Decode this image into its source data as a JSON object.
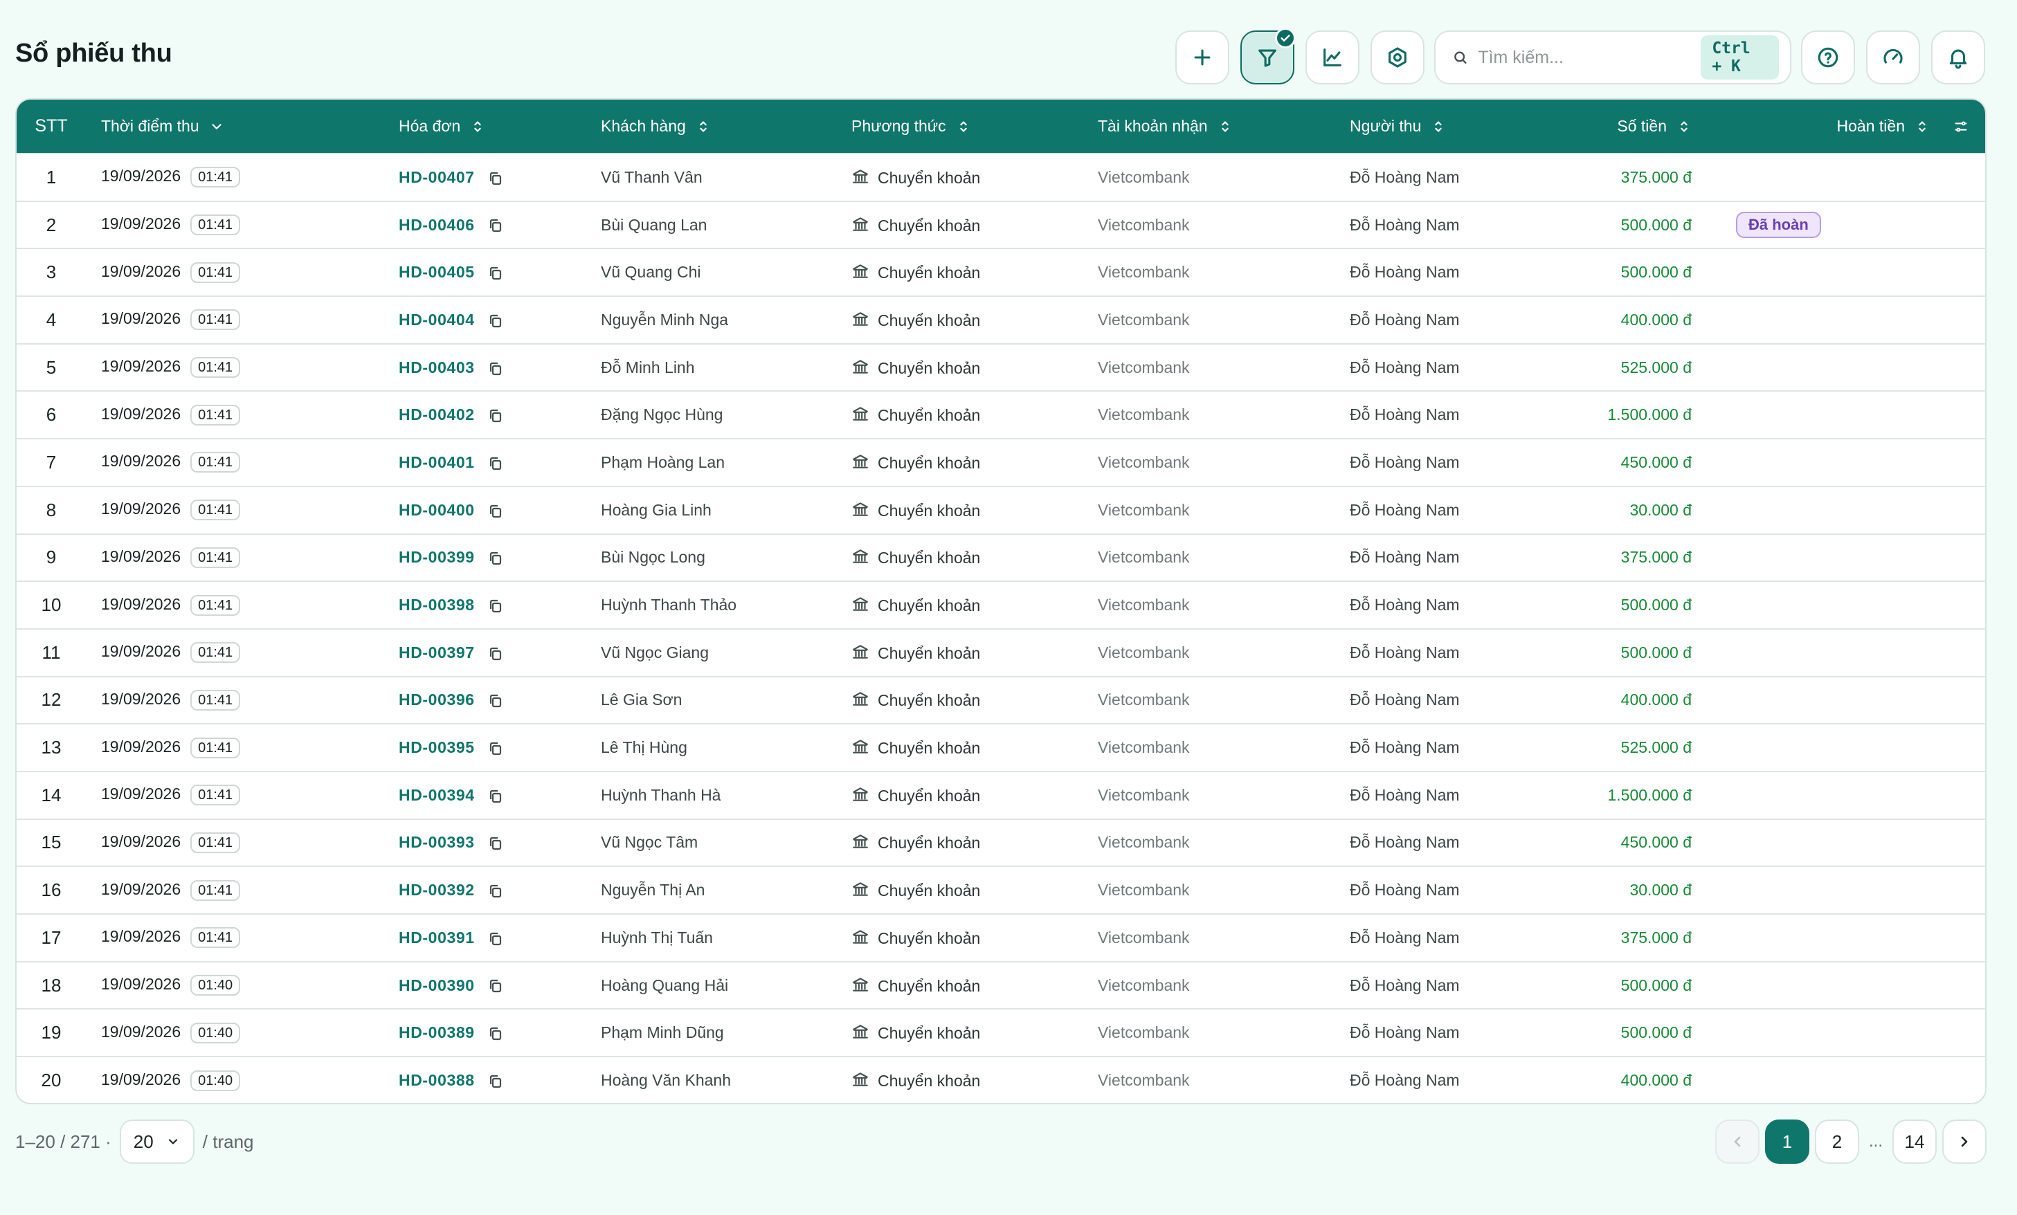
{
  "page_title": "Sổ phiếu thu",
  "search": {
    "placeholder": "Tìm kiếm...",
    "shortcut": "Ctrl + K"
  },
  "table": {
    "columns": {
      "stt": "STT",
      "time": "Thời điểm thu",
      "invoice": "Hóa đơn",
      "customer": "Khách hàng",
      "method": "Phương thức",
      "account": "Tài khoản nhận",
      "collector": "Người thu",
      "amount": "Số tiền",
      "refund": "Hoàn tiền"
    },
    "rows": [
      {
        "stt": "1",
        "date": "19/09/2026",
        "time": "01:41",
        "invoice": "HD-00407",
        "customer": "Vũ Thanh Vân",
        "method": "Chuyển khoản",
        "account": "Vietcombank",
        "collector": "Đỗ Hoàng Nam",
        "amount": "375.000 đ",
        "refund": ""
      },
      {
        "stt": "2",
        "date": "19/09/2026",
        "time": "01:41",
        "invoice": "HD-00406",
        "customer": "Bùi Quang Lan",
        "method": "Chuyển khoản",
        "account": "Vietcombank",
        "collector": "Đỗ Hoàng Nam",
        "amount": "500.000 đ",
        "refund": "Đã hoàn"
      },
      {
        "stt": "3",
        "date": "19/09/2026",
        "time": "01:41",
        "invoice": "HD-00405",
        "customer": "Vũ Quang Chi",
        "method": "Chuyển khoản",
        "account": "Vietcombank",
        "collector": "Đỗ Hoàng Nam",
        "amount": "500.000 đ",
        "refund": ""
      },
      {
        "stt": "4",
        "date": "19/09/2026",
        "time": "01:41",
        "invoice": "HD-00404",
        "customer": "Nguyễn Minh Nga",
        "method": "Chuyển khoản",
        "account": "Vietcombank",
        "collector": "Đỗ Hoàng Nam",
        "amount": "400.000 đ",
        "refund": ""
      },
      {
        "stt": "5",
        "date": "19/09/2026",
        "time": "01:41",
        "invoice": "HD-00403",
        "customer": "Đỗ Minh Linh",
        "method": "Chuyển khoản",
        "account": "Vietcombank",
        "collector": "Đỗ Hoàng Nam",
        "amount": "525.000 đ",
        "refund": ""
      },
      {
        "stt": "6",
        "date": "19/09/2026",
        "time": "01:41",
        "invoice": "HD-00402",
        "customer": "Đặng Ngọc Hùng",
        "method": "Chuyển khoản",
        "account": "Vietcombank",
        "collector": "Đỗ Hoàng Nam",
        "amount": "1.500.000 đ",
        "refund": ""
      },
      {
        "stt": "7",
        "date": "19/09/2026",
        "time": "01:41",
        "invoice": "HD-00401",
        "customer": "Phạm Hoàng Lan",
        "method": "Chuyển khoản",
        "account": "Vietcombank",
        "collector": "Đỗ Hoàng Nam",
        "amount": "450.000 đ",
        "refund": ""
      },
      {
        "stt": "8",
        "date": "19/09/2026",
        "time": "01:41",
        "invoice": "HD-00400",
        "customer": "Hoàng Gia Linh",
        "method": "Chuyển khoản",
        "account": "Vietcombank",
        "collector": "Đỗ Hoàng Nam",
        "amount": "30.000 đ",
        "refund": ""
      },
      {
        "stt": "9",
        "date": "19/09/2026",
        "time": "01:41",
        "invoice": "HD-00399",
        "customer": "Bùi Ngọc Long",
        "method": "Chuyển khoản",
        "account": "Vietcombank",
        "collector": "Đỗ Hoàng Nam",
        "amount": "375.000 đ",
        "refund": ""
      },
      {
        "stt": "10",
        "date": "19/09/2026",
        "time": "01:41",
        "invoice": "HD-00398",
        "customer": "Huỳnh Thanh Thảo",
        "method": "Chuyển khoản",
        "account": "Vietcombank",
        "collector": "Đỗ Hoàng Nam",
        "amount": "500.000 đ",
        "refund": ""
      },
      {
        "stt": "11",
        "date": "19/09/2026",
        "time": "01:41",
        "invoice": "HD-00397",
        "customer": "Vũ Ngọc Giang",
        "method": "Chuyển khoản",
        "account": "Vietcombank",
        "collector": "Đỗ Hoàng Nam",
        "amount": "500.000 đ",
        "refund": ""
      },
      {
        "stt": "12",
        "date": "19/09/2026",
        "time": "01:41",
        "invoice": "HD-00396",
        "customer": "Lê Gia Sơn",
        "method": "Chuyển khoản",
        "account": "Vietcombank",
        "collector": "Đỗ Hoàng Nam",
        "amount": "400.000 đ",
        "refund": ""
      },
      {
        "stt": "13",
        "date": "19/09/2026",
        "time": "01:41",
        "invoice": "HD-00395",
        "customer": "Lê Thị Hùng",
        "method": "Chuyển khoản",
        "account": "Vietcombank",
        "collector": "Đỗ Hoàng Nam",
        "amount": "525.000 đ",
        "refund": ""
      },
      {
        "stt": "14",
        "date": "19/09/2026",
        "time": "01:41",
        "invoice": "HD-00394",
        "customer": "Huỳnh Thanh Hà",
        "method": "Chuyển khoản",
        "account": "Vietcombank",
        "collector": "Đỗ Hoàng Nam",
        "amount": "1.500.000 đ",
        "refund": ""
      },
      {
        "stt": "15",
        "date": "19/09/2026",
        "time": "01:41",
        "invoice": "HD-00393",
        "customer": "Vũ Ngọc Tâm",
        "method": "Chuyển khoản",
        "account": "Vietcombank",
        "collector": "Đỗ Hoàng Nam",
        "amount": "450.000 đ",
        "refund": ""
      },
      {
        "stt": "16",
        "date": "19/09/2026",
        "time": "01:41",
        "invoice": "HD-00392",
        "customer": "Nguyễn Thị An",
        "method": "Chuyển khoản",
        "account": "Vietcombank",
        "collector": "Đỗ Hoàng Nam",
        "amount": "30.000 đ",
        "refund": ""
      },
      {
        "stt": "17",
        "date": "19/09/2026",
        "time": "01:41",
        "invoice": "HD-00391",
        "customer": "Huỳnh Thị Tuấn",
        "method": "Chuyển khoản",
        "account": "Vietcombank",
        "collector": "Đỗ Hoàng Nam",
        "amount": "375.000 đ",
        "refund": ""
      },
      {
        "stt": "18",
        "date": "19/09/2026",
        "time": "01:40",
        "invoice": "HD-00390",
        "customer": "Hoàng Quang Hải",
        "method": "Chuyển khoản",
        "account": "Vietcombank",
        "collector": "Đỗ Hoàng Nam",
        "amount": "500.000 đ",
        "refund": ""
      },
      {
        "stt": "19",
        "date": "19/09/2026",
        "time": "01:40",
        "invoice": "HD-00389",
        "customer": "Phạm Minh Dũng",
        "method": "Chuyển khoản",
        "account": "Vietcombank",
        "collector": "Đỗ Hoàng Nam",
        "amount": "500.000 đ",
        "refund": ""
      },
      {
        "stt": "20",
        "date": "19/09/2026",
        "time": "01:40",
        "invoice": "HD-00388",
        "customer": "Hoàng Văn Khanh",
        "method": "Chuyển khoản",
        "account": "Vietcombank",
        "collector": "Đỗ Hoàng Nam",
        "amount": "400.000 đ",
        "refund": ""
      }
    ]
  },
  "pagination": {
    "range": "1–20 / 271 ·",
    "page_size": "20",
    "per_page_label": "/ trang",
    "current_page": "1",
    "next_page": "2",
    "ellipsis": "...",
    "last_page": "14"
  },
  "colors": {
    "primary": "#0f766b",
    "amount": "#178a35",
    "refund_badge": "#6a3fb4",
    "background": "#f1fbf8"
  },
  "icons": [
    "plus-icon",
    "filter-icon",
    "check-icon",
    "chart-icon",
    "settings-icon",
    "search-icon",
    "help-icon",
    "speedometer-icon",
    "bell-icon",
    "sort-icon",
    "chevron-down-icon",
    "column-settings-icon",
    "copy-icon",
    "bank-icon",
    "chevron-left-icon",
    "chevron-right-icon"
  ]
}
